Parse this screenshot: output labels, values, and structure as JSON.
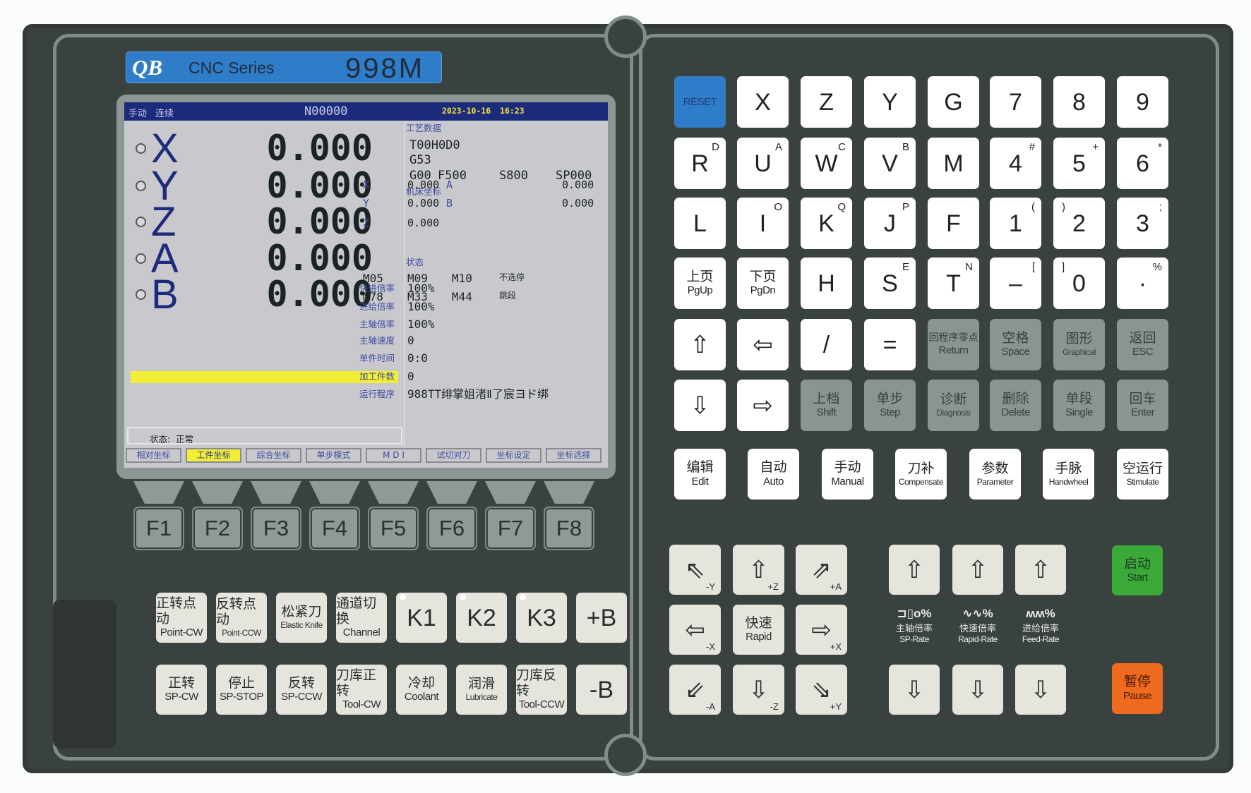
{
  "brand": {
    "logo": "QB",
    "series": "CNC  Series",
    "model": "998M"
  },
  "screen": {
    "mode": "手动",
    "mode2": "连续",
    "program_no": "N00000",
    "date": "2023-10-16",
    "time": "16:23",
    "axes": [
      {
        "name": "X",
        "value": "0.000"
      },
      {
        "name": "Y",
        "value": "0.000"
      },
      {
        "name": "Z",
        "value": "0.000"
      },
      {
        "name": "A",
        "value": "0.000"
      },
      {
        "name": "B",
        "value": "0.000"
      }
    ],
    "status_label": "状态:",
    "status_value": "正常",
    "tech_title": "工艺数据",
    "tool": "T00H0D0",
    "coord_sys": "G53",
    "gmode": "G00",
    "feed": "F500",
    "speed": "S800",
    "sp": "SP000",
    "machine_title": "机床坐标",
    "machine": [
      {
        "a": "X",
        "av": "0.000",
        "b": "A",
        "bv": "0.000"
      },
      {
        "a": "Y",
        "av": "0.000",
        "b": "B",
        "bv": "0.000"
      },
      {
        "a": "Z",
        "av": "0.000"
      }
    ],
    "state_title": "状态",
    "mcodes": [
      [
        "M05",
        "M09",
        "M10",
        "不选停"
      ],
      [
        "M78",
        "M33",
        "M44",
        "跳段"
      ]
    ],
    "info": [
      {
        "label": "快进倍率",
        "value": "100%"
      },
      {
        "label": "进给倍率",
        "value": "100%"
      },
      {
        "label": "主轴倍率",
        "value": "100%"
      },
      {
        "label": "主轴速度",
        "value": "0"
      },
      {
        "label": "单件时间",
        "value": "0:0"
      },
      {
        "label": "加工件数",
        "value": "0"
      },
      {
        "label": "运行程序",
        "value": "988TT绯掌姐渚Ⅱ了宸ヨド绑"
      }
    ],
    "tabs": [
      "相对坐标",
      "工件坐标",
      "综合坐标",
      "单步模式",
      "M D I",
      "试切对刀",
      "坐标设定",
      "坐标选择"
    ],
    "selected_tab": 1
  },
  "fkeys": [
    "F1",
    "F2",
    "F3",
    "F4",
    "F5",
    "F6",
    "F7",
    "F8"
  ],
  "keypad": [
    [
      {
        "main": "RESET",
        "style": "blue"
      },
      {
        "main": "X"
      },
      {
        "main": "Z"
      },
      {
        "main": "Y"
      },
      {
        "main": "G"
      },
      {
        "main": "7"
      },
      {
        "main": "8"
      },
      {
        "main": "9"
      }
    ],
    [
      {
        "main": "R",
        "sup": "D"
      },
      {
        "main": "U",
        "sup": "A"
      },
      {
        "main": "W",
        "sup": "C"
      },
      {
        "main": "V",
        "sup": "B"
      },
      {
        "main": "M"
      },
      {
        "main": "4",
        "sup": "#"
      },
      {
        "main": "5",
        "sup": "+"
      },
      {
        "main": "6",
        "sup": "*"
      }
    ],
    [
      {
        "main": "L"
      },
      {
        "main": "I",
        "sup": "O"
      },
      {
        "main": "K",
        "sup": "Q"
      },
      {
        "main": "J",
        "sup": "P"
      },
      {
        "main": "F"
      },
      {
        "main": "1",
        "sup": "("
      },
      {
        "main": "2",
        "sup_left": ")"
      },
      {
        "main": "3",
        "sup": ";"
      }
    ],
    [
      {
        "cn": "上页",
        "en": "PgUp"
      },
      {
        "cn": "下页",
        "en": "PgDn"
      },
      {
        "main": "H"
      },
      {
        "main": "S",
        "sup": "E"
      },
      {
        "main": "T",
        "sup": "N"
      },
      {
        "main": "–",
        "sup": "["
      },
      {
        "main": "0",
        "sup_left": "]"
      },
      {
        "main": "·",
        "sup": "%"
      }
    ],
    [
      {
        "main": "⇧",
        "icon": "arrow-up-icon"
      },
      {
        "main": "⇦",
        "icon": "arrow-left-icon"
      },
      {
        "main": "/"
      },
      {
        "main": "="
      },
      {
        "cn": "回程序零点",
        "en": "Return",
        "style": "gray"
      },
      {
        "cn": "空格",
        "en": "Space",
        "style": "gray"
      },
      {
        "cn": "图形",
        "en": "Graphical",
        "style": "gray"
      },
      {
        "cn": "返回",
        "en": "ESC",
        "style": "gray"
      }
    ],
    [
      {
        "main": "⇩",
        "icon": "arrow-down-icon"
      },
      {
        "main": "⇨",
        "icon": "arrow-right-icon"
      },
      {
        "cn": "上档",
        "en": "Shift",
        "style": "gray"
      },
      {
        "cn": "单步",
        "en": "Step",
        "style": "gray"
      },
      {
        "cn": "诊断",
        "en": "Diagnosis",
        "style": "gray"
      },
      {
        "cn": "删除",
        "en": "Delete",
        "style": "gray"
      },
      {
        "cn": "单段",
        "en": "Single",
        "style": "gray"
      },
      {
        "cn": "回车",
        "en": "Enter",
        "style": "gray"
      }
    ]
  ],
  "modes": [
    {
      "cn": "编辑",
      "en": "Edit"
    },
    {
      "cn": "自动",
      "en": "Auto"
    },
    {
      "cn": "手动",
      "en": "Manual"
    },
    {
      "cn": "刀补",
      "en": "Compensate"
    },
    {
      "cn": "参数",
      "en": "Parameter"
    },
    {
      "cn": "手脉",
      "en": "Handwheel"
    },
    {
      "cn": "空运行",
      "en": "Stimulate"
    }
  ],
  "func_keys": [
    [
      {
        "cn": "正转点动",
        "en": "Point-CW"
      },
      {
        "cn": "反转点动",
        "en": "Point-CCW"
      },
      {
        "cn": "松紧刀",
        "en": "Elastic Knife"
      },
      {
        "cn": "通道切换",
        "en": "Channel"
      },
      {
        "main": "K1",
        "led": true
      },
      {
        "main": "K2",
        "led": true
      },
      {
        "main": "K3",
        "led": true
      },
      {
        "main": "+B"
      }
    ],
    [
      {
        "cn": "正转",
        "en": "SP-CW"
      },
      {
        "cn": "停止",
        "en": "SP-STOP"
      },
      {
        "cn": "反转",
        "en": "SP-CCW"
      },
      {
        "cn": "刀库正转",
        "en": "Tool-CW"
      },
      {
        "cn": "冷却",
        "en": "Coolant"
      },
      {
        "cn": "润滑",
        "en": "Lubricate"
      },
      {
        "cn": "刀库反转",
        "en": "Tool-CCW"
      },
      {
        "main": "-B"
      }
    ]
  ],
  "jog": [
    [
      {
        "main": "⇖",
        "sub": "-Y"
      },
      {
        "main": "⇧",
        "sub": "+Z"
      },
      {
        "main": "⇗",
        "sub": "+A"
      }
    ],
    [
      {
        "main": "⇦",
        "sub": "-X"
      },
      {
        "cn": "快速",
        "en": "Rapid"
      },
      {
        "main": "⇨",
        "sub": "+X"
      }
    ],
    [
      {
        "main": "⇙",
        "sub": "-A"
      },
      {
        "main": "⇩",
        "sub": "-Z"
      },
      {
        "main": "⇘",
        "sub": "+Y"
      }
    ]
  ],
  "overrides": [
    {
      "symbol": "⊐▯o%",
      "cn": "主轴倍率",
      "en": "SP-Rate"
    },
    {
      "symbol": "∿∿%",
      "cn": "快速倍率",
      "en": "Rapid-Rate"
    },
    {
      "symbol": "ʍʍ%",
      "cn": "进给倍率",
      "en": "Feed-Rate"
    }
  ],
  "start": {
    "cn": "启动",
    "en": "Start",
    "color": "#3aa93a"
  },
  "pause": {
    "cn": "暂停",
    "en": "Pause",
    "color": "#ee6a1e"
  },
  "colors": {
    "reset": "#2f7cc9",
    "screen_title": "#1d2b7c",
    "progress": "#f1ee36"
  }
}
